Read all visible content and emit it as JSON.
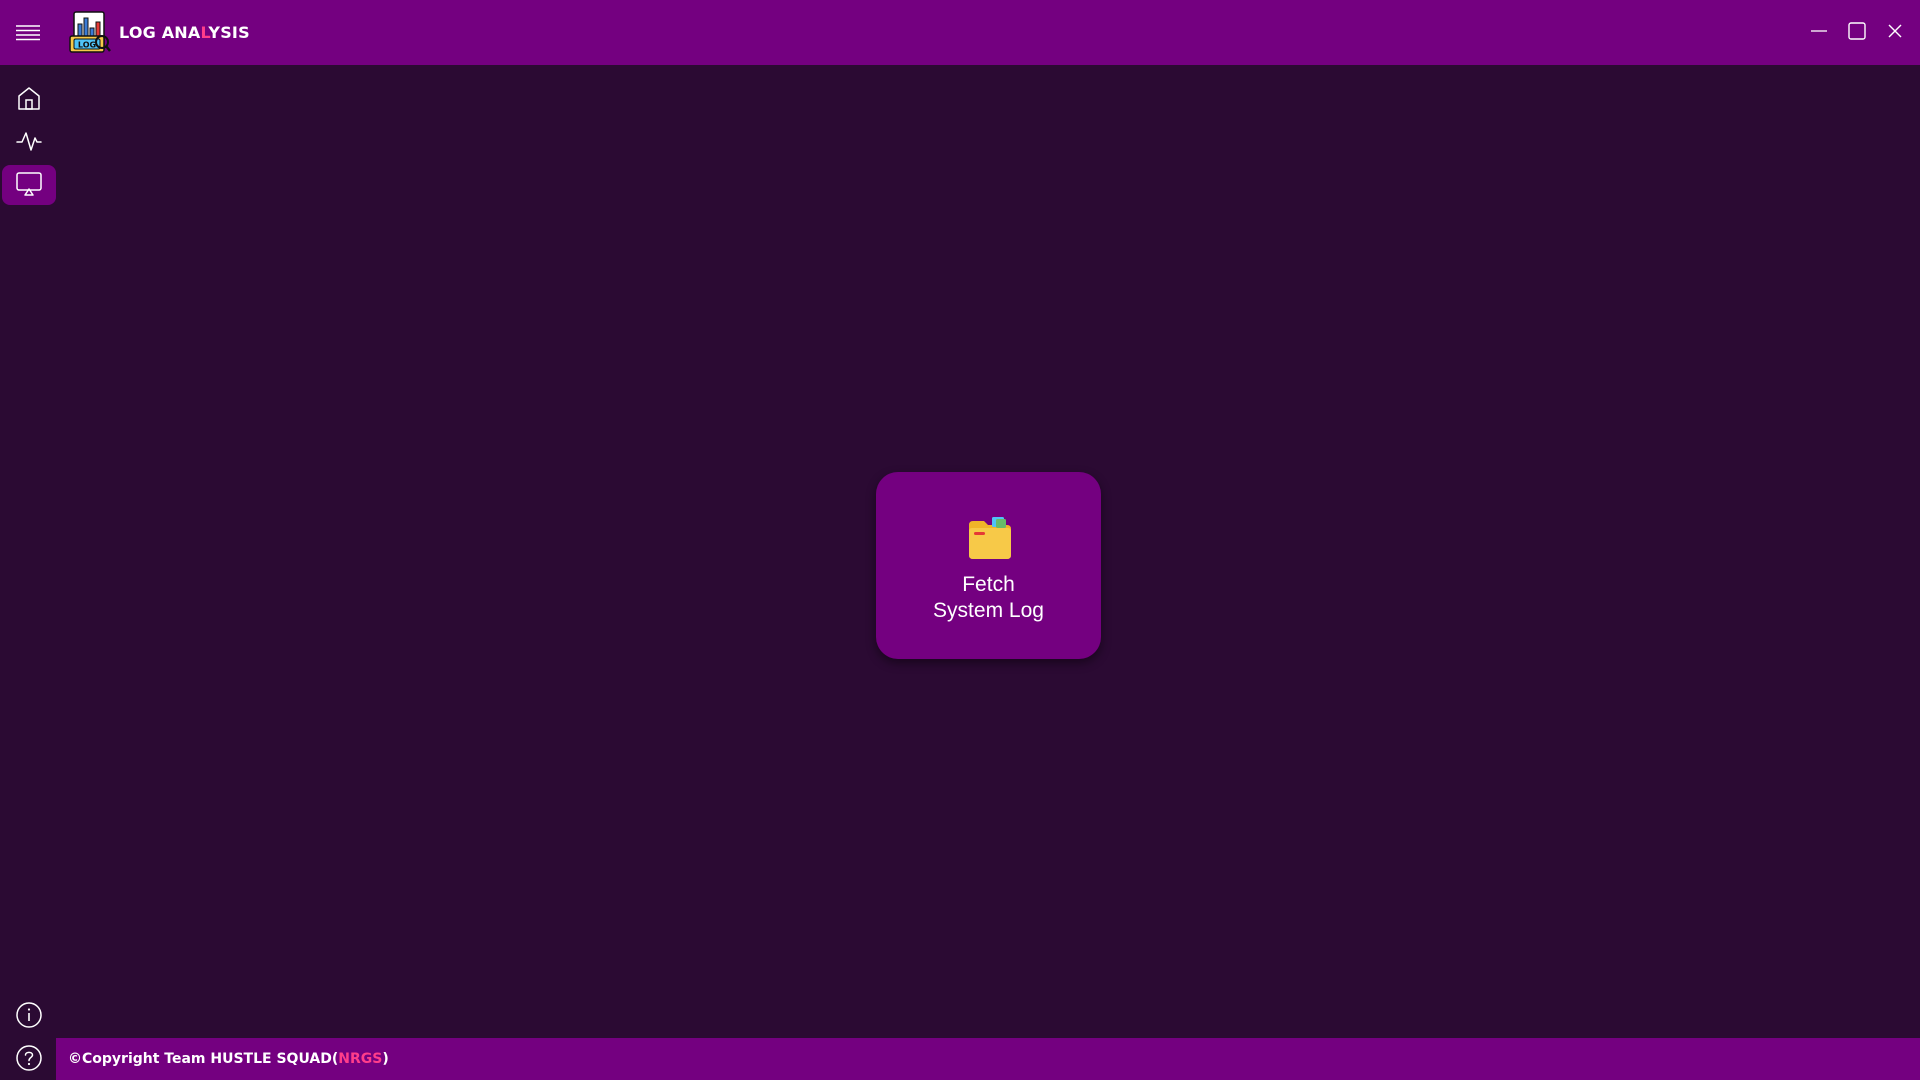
{
  "titlebar": {
    "title_part1": "LOG ANA",
    "title_accent": "L",
    "title_part2": "YSIS",
    "logo_text": "LOG",
    "menu_icon": "hamburger-menu-icon",
    "minimize_icon": "minimize-icon",
    "maximize_icon": "maximize-icon",
    "close_icon": "close-icon"
  },
  "sidebar": {
    "items": [
      {
        "name": "home",
        "icon": "home-icon",
        "active": false
      },
      {
        "name": "activity",
        "icon": "pulse-icon",
        "active": false
      },
      {
        "name": "display",
        "icon": "screen-icon",
        "active": true
      }
    ],
    "bottom_items": [
      {
        "name": "info",
        "icon": "info-icon"
      },
      {
        "name": "help",
        "icon": "help-icon"
      }
    ]
  },
  "main": {
    "fetch_button": {
      "line1": "Fetch",
      "line2": "System Log",
      "icon": "folder-icon"
    }
  },
  "footer": {
    "text_prefix": "©Copyright Team HUSTLE SQUAD(",
    "text_accent": "NRGS",
    "text_suffix": ")"
  },
  "colors": {
    "background": "#2b0a33",
    "bar": "#740080",
    "accent": "#ff3d8a",
    "folder": "#f7c948"
  }
}
